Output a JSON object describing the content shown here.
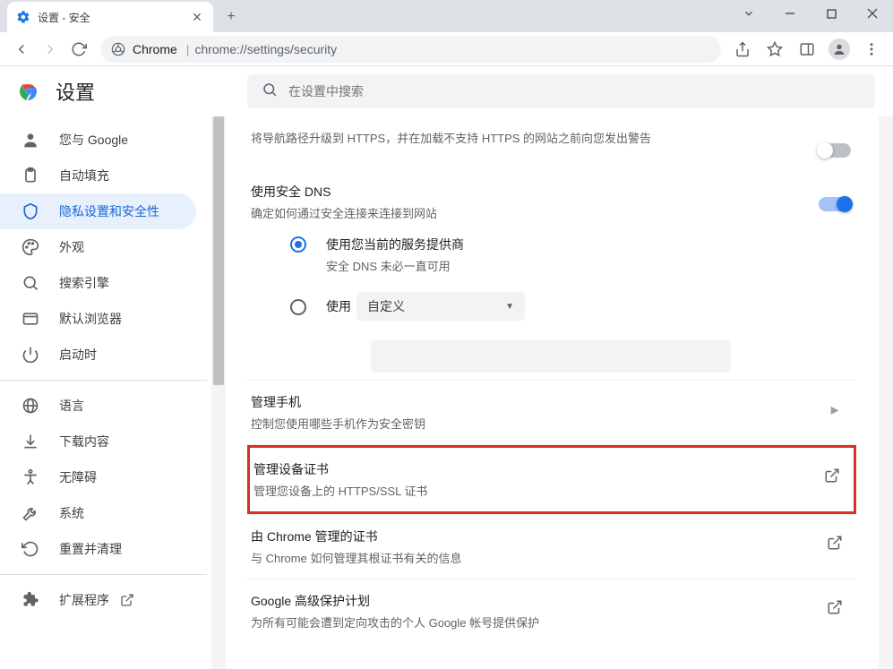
{
  "window": {
    "tab_title": "设置 - 安全"
  },
  "omnibox": {
    "label_chrome": "Chrome",
    "url": "chrome://settings/security"
  },
  "settings_title": "设置",
  "search_placeholder": "在设置中搜索",
  "sidebar": {
    "items": [
      {
        "label": "您与 Google"
      },
      {
        "label": "自动填充"
      },
      {
        "label": "隐私设置和安全性"
      },
      {
        "label": "外观"
      },
      {
        "label": "搜索引擎"
      },
      {
        "label": "默认浏览器"
      },
      {
        "label": "启动时"
      }
    ],
    "items2": [
      {
        "label": "语言"
      },
      {
        "label": "下载内容"
      },
      {
        "label": "无障碍"
      },
      {
        "label": "系统"
      },
      {
        "label": "重置并清理"
      }
    ],
    "ext_label": "扩展程序"
  },
  "main": {
    "https_warning": "将导航路径升级到 HTTPS，并在加载不支持 HTTPS 的网站之前向您发出警告",
    "secure_dns": {
      "title": "使用安全 DNS",
      "sub": "确定如何通过安全连接来连接到网站",
      "opt1": {
        "label": "使用您当前的服务提供商",
        "sub": "安全 DNS 未必一直可用"
      },
      "opt2": {
        "label": "使用",
        "select_value": "自定义"
      }
    },
    "phone": {
      "title": "管理手机",
      "sub": "控制您使用哪些手机作为安全密钥"
    },
    "certs": {
      "title": "管理设备证书",
      "sub": "管理您设备上的 HTTPS/SSL 证书"
    },
    "chrome_certs": {
      "title": "由 Chrome 管理的证书",
      "sub": "与 Chrome 如何管理其根证书有关的信息"
    },
    "adv_protect": {
      "title": "Google 高级保护计划",
      "sub": "为所有可能会遭到定向攻击的个人 Google 帐号提供保护"
    }
  }
}
